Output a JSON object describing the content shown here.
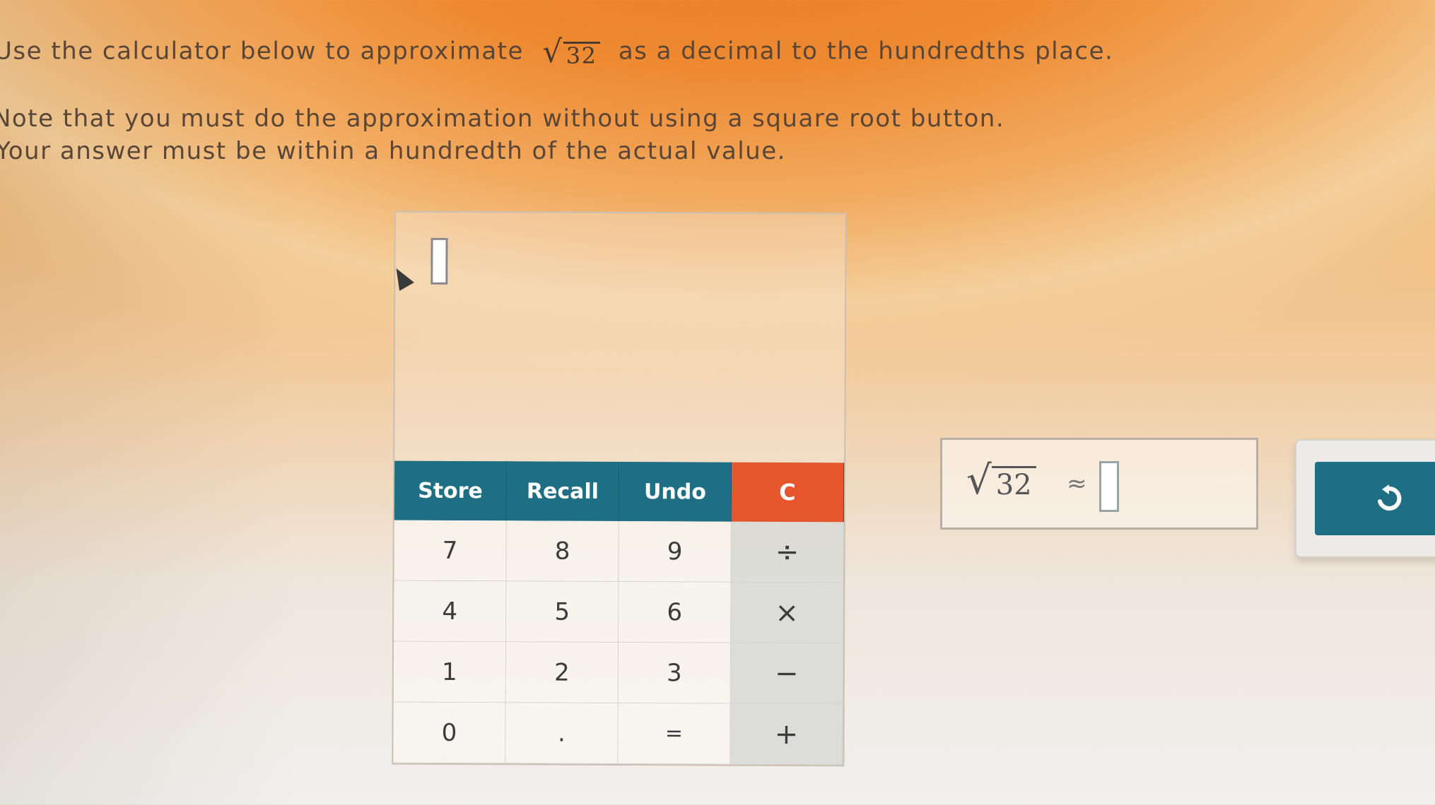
{
  "instructions": {
    "line1_before": "Use the calculator below to approximate",
    "line1_radicand": "32",
    "line1_after": "as a decimal to the hundredths place.",
    "line2": "Note that you must do the approximation without using a square root button.",
    "line3": "Your answer must be within a hundredth of the actual value."
  },
  "calculator": {
    "function_keys": [
      "Store",
      "Recall",
      "Undo",
      "C"
    ],
    "rows": [
      [
        "7",
        "8",
        "9",
        "÷"
      ],
      [
        "4",
        "5",
        "6",
        "×"
      ],
      [
        "1",
        "2",
        "3",
        "−"
      ],
      [
        "0",
        ".",
        "=",
        "+"
      ]
    ]
  },
  "answer": {
    "radicand": "32",
    "approx_symbol": "≈"
  },
  "icons": {
    "undo": "undo-arrow-icon",
    "pointer": "mouse-pointer-icon"
  },
  "colors": {
    "teal": "#1f6f84",
    "clear": "#e7552c"
  }
}
